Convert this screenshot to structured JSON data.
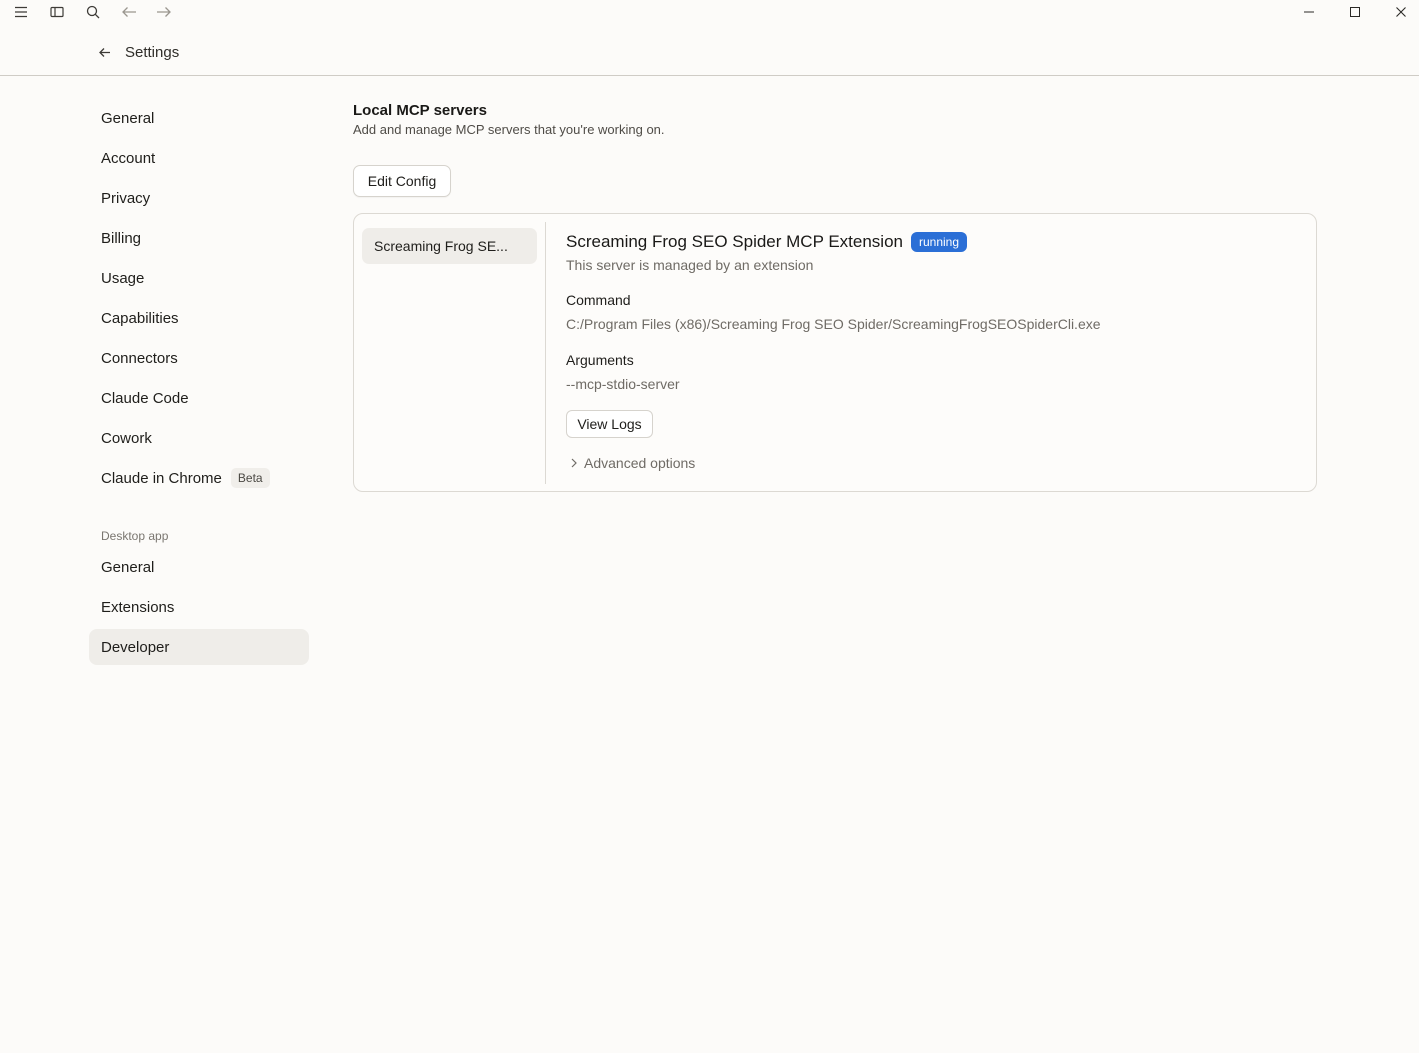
{
  "titlebar": {
    "icons": [
      "menu-icon",
      "sidebar-toggle-icon",
      "search-icon",
      "arrow-left-icon",
      "arrow-right-icon"
    ],
    "window_controls": [
      "minimize-icon",
      "maximize-icon",
      "close-icon"
    ]
  },
  "header": {
    "title": "Settings"
  },
  "sidebar": {
    "items": [
      {
        "label": "General"
      },
      {
        "label": "Account"
      },
      {
        "label": "Privacy"
      },
      {
        "label": "Billing"
      },
      {
        "label": "Usage"
      },
      {
        "label": "Capabilities"
      },
      {
        "label": "Connectors"
      },
      {
        "label": "Claude Code"
      },
      {
        "label": "Cowork"
      },
      {
        "label": "Claude in Chrome",
        "badge": "Beta"
      }
    ],
    "section_label": "Desktop app",
    "desktop_items": [
      {
        "label": "General"
      },
      {
        "label": "Extensions"
      },
      {
        "label": "Developer",
        "active": true
      }
    ]
  },
  "main": {
    "title": "Local MCP servers",
    "subtitle": "Add and manage MCP servers that you're working on.",
    "edit_config_label": "Edit Config",
    "servers": [
      {
        "short_name": "Screaming Frog SE..."
      }
    ],
    "selected_server": {
      "name": "Screaming Frog SEO Spider MCP Extension",
      "status": "running",
      "status_color": "#2b6fd6",
      "managed_note": "This server is managed by an extension",
      "command_label": "Command",
      "command_value": "C:/Program Files (x86)/Screaming Frog SEO Spider/ScreamingFrogSEOSpiderCli.exe",
      "arguments_label": "Arguments",
      "arguments_value": "--mcp-stdio-server",
      "view_logs_label": "View Logs",
      "advanced_label": "Advanced options"
    }
  }
}
